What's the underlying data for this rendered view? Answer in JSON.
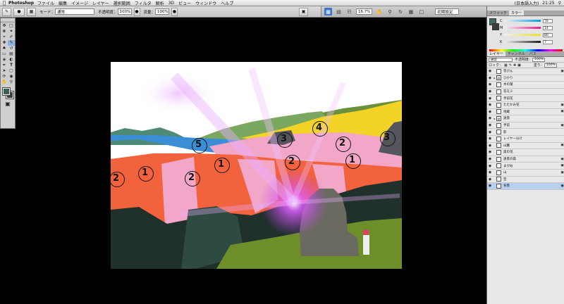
{
  "menubar": {
    "apple": "",
    "app_name": "Photoshop",
    "menus": [
      "ファイル",
      "編集",
      "イメージ",
      "レイヤー",
      "選択範囲",
      "フィルタ",
      "解析",
      "3D",
      "ビュー",
      "ウィンドウ",
      "ヘルプ"
    ],
    "clock": "21:25",
    "status": "(日本語入力)"
  },
  "options": {
    "mode_label": "モード：",
    "mode_value": "通常",
    "opacity_label": "不透明度：",
    "opacity_value": "100%",
    "flow_label": "流量：",
    "flow_value": "100%"
  },
  "appbar": {
    "zoom": "16.7%",
    "workspace": "初期設定"
  },
  "color_panel": {
    "tabs": [
      "スウォッチ",
      "カラー"
    ],
    "values": {
      "r": "78",
      "g": "14",
      "b": "80",
      "k": "7"
    },
    "labels": {
      "r": "C",
      "g": "M",
      "b": "Y",
      "k": "K"
    }
  },
  "layers_panel": {
    "tabs": [
      "レイヤー",
      "チャンネル",
      "パス"
    ],
    "blend_mode": "通常",
    "opacity_label": "不透明度：",
    "opacity_value": "100%",
    "lock_label": "ロック：",
    "fill_label": "塗り：",
    "fill_value": "100%",
    "layers": [
      {
        "name": "花びん",
        "locked": true,
        "selected": false,
        "group": false
      },
      {
        "name": "ひかり",
        "locked": false,
        "selected": false,
        "group": true
      },
      {
        "name": "木の葉",
        "locked": false,
        "selected": false,
        "group": false
      },
      {
        "name": "花モミ",
        "locked": false,
        "selected": false,
        "group": false
      },
      {
        "name": "手前花",
        "locked": false,
        "selected": false,
        "group": false
      },
      {
        "name": "たたかみ花",
        "locked": true,
        "selected": false,
        "group": false
      },
      {
        "name": "地蔵",
        "locked": true,
        "selected": false,
        "group": false
      },
      {
        "name": "遠景",
        "locked": false,
        "selected": false,
        "group": true
      },
      {
        "name": "手前",
        "locked": true,
        "selected": false,
        "group": false
      },
      {
        "name": "影",
        "locked": false,
        "selected": false,
        "group": false
      },
      {
        "name": "レイヤー分け",
        "locked": false,
        "selected": false,
        "group": false
      },
      {
        "name": "山麓",
        "locked": true,
        "selected": false,
        "group": false
      },
      {
        "name": "奥の花",
        "locked": false,
        "selected": false,
        "group": false
      },
      {
        "name": "遠景の森",
        "locked": true,
        "selected": false,
        "group": false
      },
      {
        "name": "まがお",
        "locked": true,
        "selected": false,
        "group": false
      },
      {
        "name": "山",
        "locked": true,
        "selected": false,
        "group": false
      },
      {
        "name": "空",
        "locked": false,
        "selected": false,
        "group": false
      },
      {
        "name": "背景",
        "locked": true,
        "selected": true,
        "group": false
      }
    ]
  },
  "canvas": {
    "region_numbers": [
      "2",
      "1",
      "2",
      "1",
      "5",
      "3",
      "4",
      "2",
      "2",
      "1",
      "3"
    ]
  },
  "colors": {
    "sky": "#ffffff",
    "yellow": "#f2d326",
    "pink": "#f2a6c8",
    "orange": "#f2623c",
    "blue": "#3a8ed6",
    "dark": "#20302a",
    "grass": "#8cb33c",
    "glow": "#d040f0"
  }
}
